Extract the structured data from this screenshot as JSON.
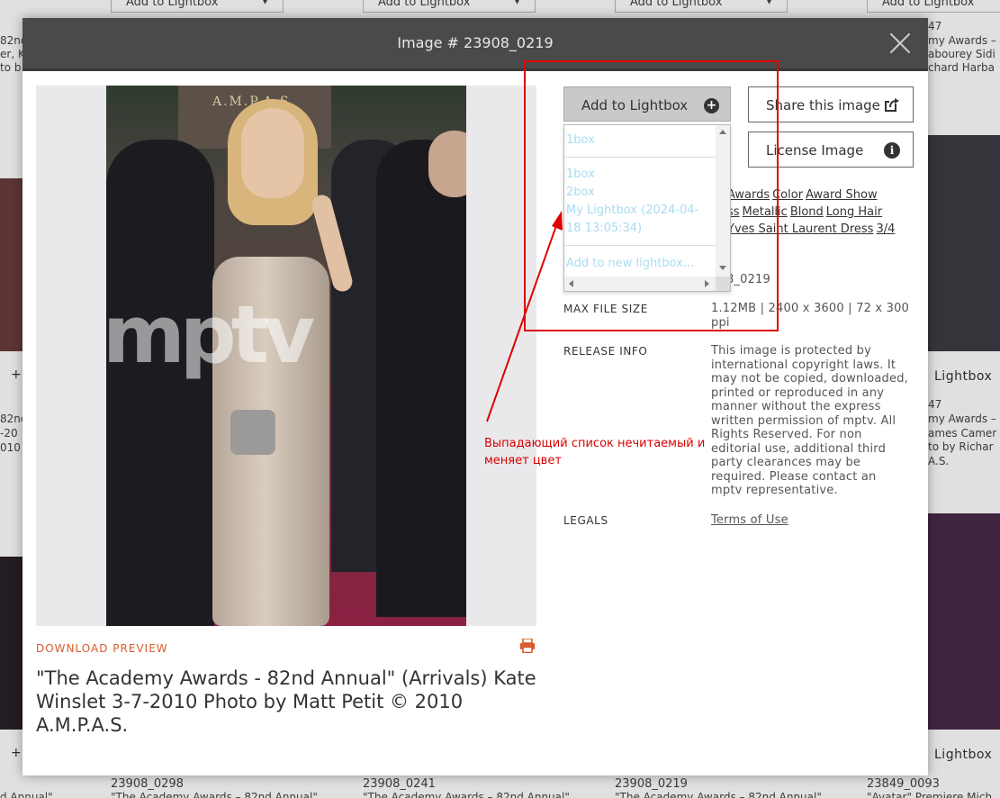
{
  "background": {
    "add_to_lightbox_label": "Add to Lightbox",
    "lightbox_label": "Lightbox",
    "captions_left": [
      "82nd",
      "er, K",
      "to b",
      "82nd",
      "-20",
      "010"
    ],
    "captions_right": [
      "47",
      "my Awards –",
      "abourey Sidi",
      "chard Harba",
      "47",
      "my Awards –",
      "ames Camer",
      "to by Richar",
      "A.S."
    ],
    "bottom_items": [
      {
        "id": "23908_0298",
        "sub": "\"The Academy Awards – 82nd Annual\""
      },
      {
        "id": "23908_0241",
        "sub": "\"The Academy Awards – 82nd Annual\""
      },
      {
        "id": "23908_0219",
        "sub": "\"The Academy Awards – 82nd Annual\""
      },
      {
        "id": "23849_0093",
        "sub": "\"Avatar\" Premiere Mich"
      }
    ],
    "bottom_left_text": "d Annual\""
  },
  "modal": {
    "title": "Image # 23908_0219",
    "download_preview": "DOWNLOAD PREVIEW",
    "caption": "\"The Academy Awards - 82nd Annual\" (Arrivals) Kate Winslet 3-7-2010 Photo by Matt Petit © 2010 A.M.P.A.S.",
    "photo": {
      "wall_text": "A.M.P.A.S.",
      "watermark": "mptv"
    },
    "buttons": {
      "add_to_lightbox": "Add to Lightbox",
      "share": "Share this image",
      "license": "License Image"
    },
    "dropdown": {
      "options": [
        "1box",
        "1box",
        "2box",
        "My Lightbox (2024-04-18 13:05:34)",
        "Add to new lightbox..."
      ],
      "text_color": "#a8dcf0"
    },
    "keywords": [
      "Awards",
      "Color",
      "Award Show",
      "ss",
      "Metallic",
      "Blond",
      "Long Hair",
      "Yves Saint Laurent Dress",
      "3/4"
    ],
    "image_id_partial": "908_0219",
    "max_file_size_label": "MAX FILE SIZE",
    "max_file_size_value": "1.12MB | 2400 x 3600 | 72 x 300 ppi",
    "release_info_label": "RELEASE INFO",
    "release_info_value": "This image is protected by international copyright laws. It may not be copied, downloaded, printed or reproduced in any manner without the express written permission of mptv. All Rights Reserved. For non editorial use, additional third party clearances may be required. Please contact an mptv representative.",
    "legals_label": "LEGALS",
    "legals_link": "Terms of Use"
  },
  "annotation": {
    "text": "Выпадающий список нечитаемый и меняет цвет",
    "color": "#e00000"
  }
}
